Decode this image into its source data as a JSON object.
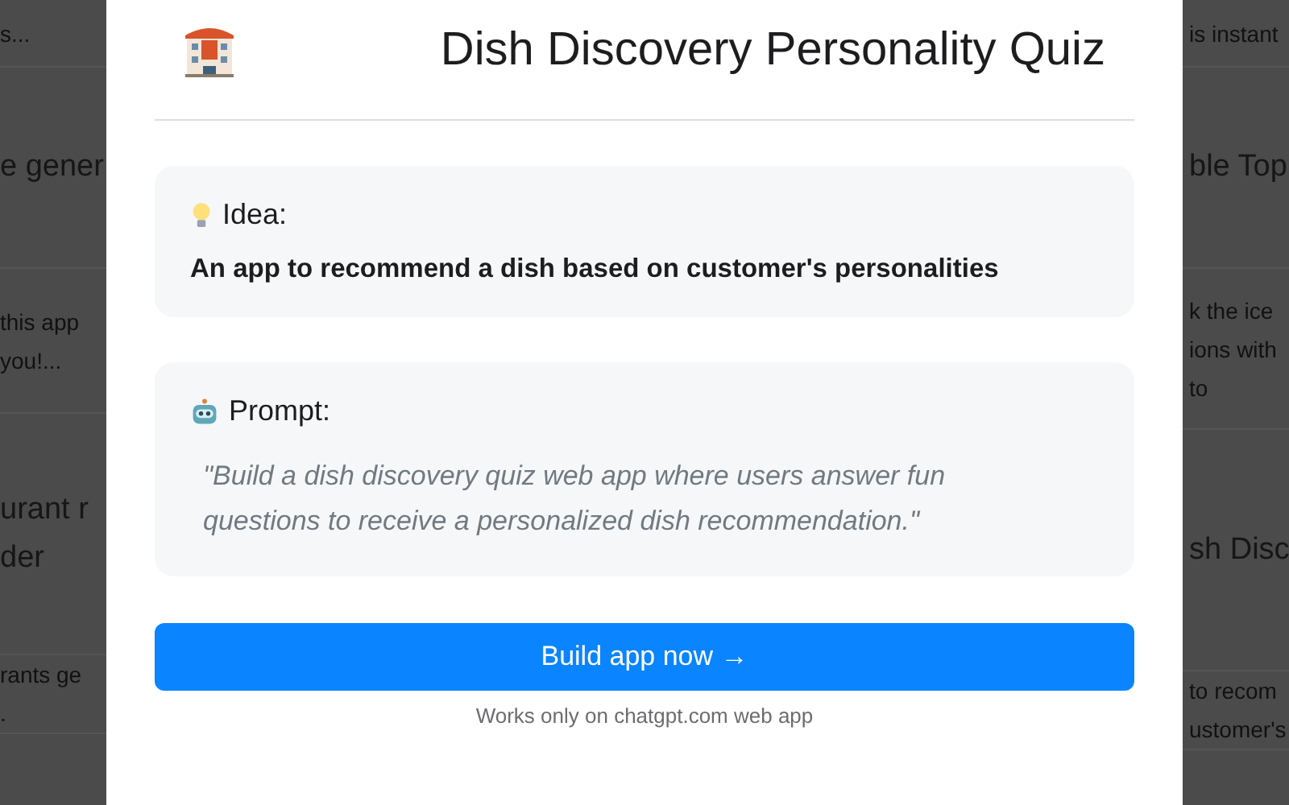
{
  "background": {
    "left_column": [
      {
        "kind": "description",
        "lines": [
          "s..."
        ]
      },
      {
        "kind": "title",
        "lines": [
          "e gener"
        ]
      },
      {
        "kind": "description",
        "lines": [
          "this app",
          "you!..."
        ]
      },
      {
        "kind": "title",
        "lines": [
          "urant r",
          "der"
        ]
      },
      {
        "kind": "description",
        "lines": [
          "rants ge",
          "."
        ]
      }
    ],
    "right_column": [
      {
        "kind": "description",
        "lines": [
          "is instant"
        ]
      },
      {
        "kind": "title",
        "lines": [
          "ble Top"
        ]
      },
      {
        "kind": "description",
        "lines": [
          "k the ice",
          "ions with",
          "to"
        ]
      },
      {
        "kind": "title",
        "lines": [
          "sh Disc"
        ]
      },
      {
        "kind": "description",
        "lines": [
          "to recom",
          "ustomer's"
        ]
      }
    ]
  },
  "modal": {
    "title": "Dish Discovery Personality Quiz",
    "idea": {
      "label": "Idea:",
      "text": "An app to recommend a dish based on customer's personalities"
    },
    "prompt": {
      "label": "Prompt:",
      "text": "\"Build a dish discovery quiz web app where users answer fun questions to receive a personalized dish recommendation.\""
    },
    "button": "Build app now →",
    "note": "Works only on chatgpt.com web app"
  }
}
